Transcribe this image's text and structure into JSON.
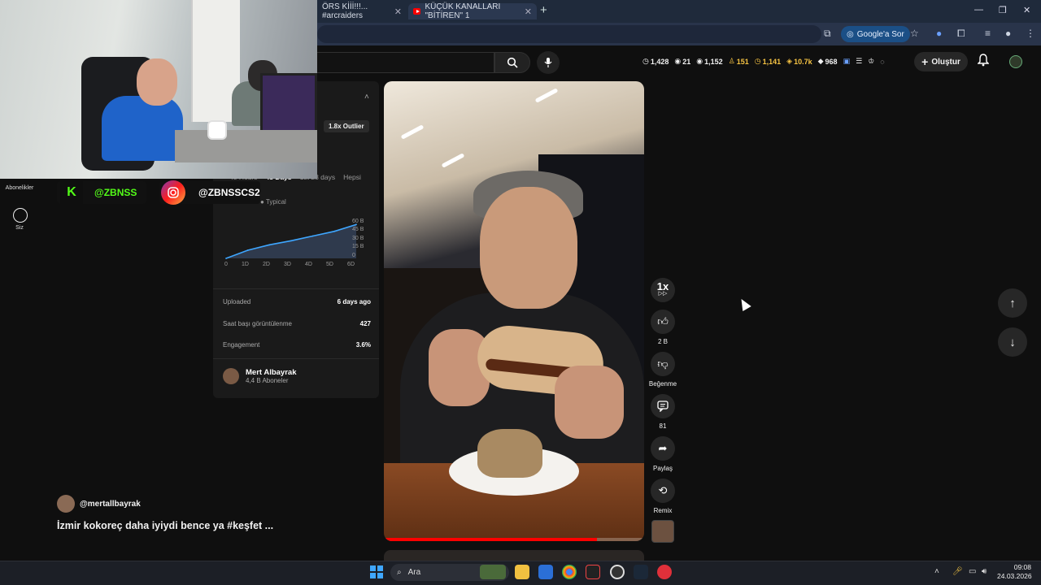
{
  "browser": {
    "tabs": [
      {
        "title": "ÖRS Kİİİ!!!... #arcraiders"
      },
      {
        "title": "KÜÇÜK KANALLARI \"BİTİREN\" 1"
      }
    ],
    "google_button": "Google'a Sor"
  },
  "topbar": {
    "stats": [
      "1,428",
      "21",
      "1,152",
      "151",
      "1,141",
      "10.7k",
      "968"
    ],
    "create_label": "Oluştur"
  },
  "overlay": {
    "kick_handle": "@ZBNSS",
    "instagram_handle": "@ZBNSSCS2"
  },
  "guide": {
    "subscriptions": "Abonelikler",
    "you": "Siz"
  },
  "panel": {
    "outlier": "1.8x Outlier",
    "ranges": [
      "48 Hours",
      "48 Days",
      "1st 28 days",
      "Hepsi"
    ],
    "legend_typical": "Typical",
    "uploaded_label": "Uploaded",
    "uploaded_value": "6 days ago",
    "hourly_label": "Saat başı görüntülenme",
    "hourly_value": "427",
    "engagement_label": "Engagement",
    "engagement_value": "3.6%",
    "creator_name": "Mert Albayrak",
    "creator_subs": "4,4 B Aboneler"
  },
  "chart_data": {
    "type": "line",
    "x": [
      "0",
      "1D",
      "2D",
      "3D",
      "4D",
      "5D",
      "6D"
    ],
    "y_ticks": [
      "60 B",
      "45 B",
      "30 B",
      "15 B",
      "0"
    ],
    "series": [
      {
        "values": [
          0,
          12,
          20,
          26,
          33,
          40,
          50
        ]
      }
    ],
    "ylim": [
      0,
      60
    ]
  },
  "video": {
    "progress": 0.82
  },
  "actions": {
    "speed": "1x",
    "likes": "2 B",
    "dislike_label": "Beğenme",
    "comments": "81",
    "share_label": "Paylaş",
    "remix_label": "Remix"
  },
  "short": {
    "channel": "@mertallbayrak",
    "caption": "İzmir kokoreç daha iyiydi bence ya #keşfet ..."
  },
  "taskbar": {
    "search_placeholder": "Ara",
    "time": "09:08",
    "date": "24.03.2026"
  },
  "colors": {
    "accent_red": "#ff0000",
    "kick_green": "#53fc18",
    "chart_line": "#3ea6ff"
  }
}
